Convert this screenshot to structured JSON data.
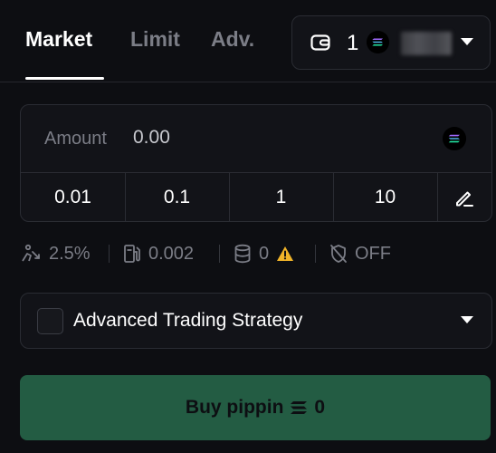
{
  "tabs": [
    {
      "label": "Market",
      "active": true
    },
    {
      "label": "Limit",
      "active": false
    },
    {
      "label": "Adv.",
      "active": false
    }
  ],
  "wallet": {
    "count": "1",
    "icon": "wallet-icon",
    "token_icon": "solana-logo-icon"
  },
  "amount": {
    "label": "Amount",
    "placeholder": "0.00",
    "currency_icon": "solana-logo-icon"
  },
  "presets": [
    "0.01",
    "0.1",
    "1",
    "10"
  ],
  "info": {
    "slippage": "2.5%",
    "priority_fee": "0.002",
    "bribe": "0",
    "mev_protection": "OFF"
  },
  "strategy": {
    "label": "Advanced Trading Strategy"
  },
  "buy": {
    "prefix": "Buy pippin",
    "amount": "0"
  },
  "colors": {
    "accent_button": "#235c43",
    "warning": "#f0b429",
    "background": "#0d0e12"
  }
}
